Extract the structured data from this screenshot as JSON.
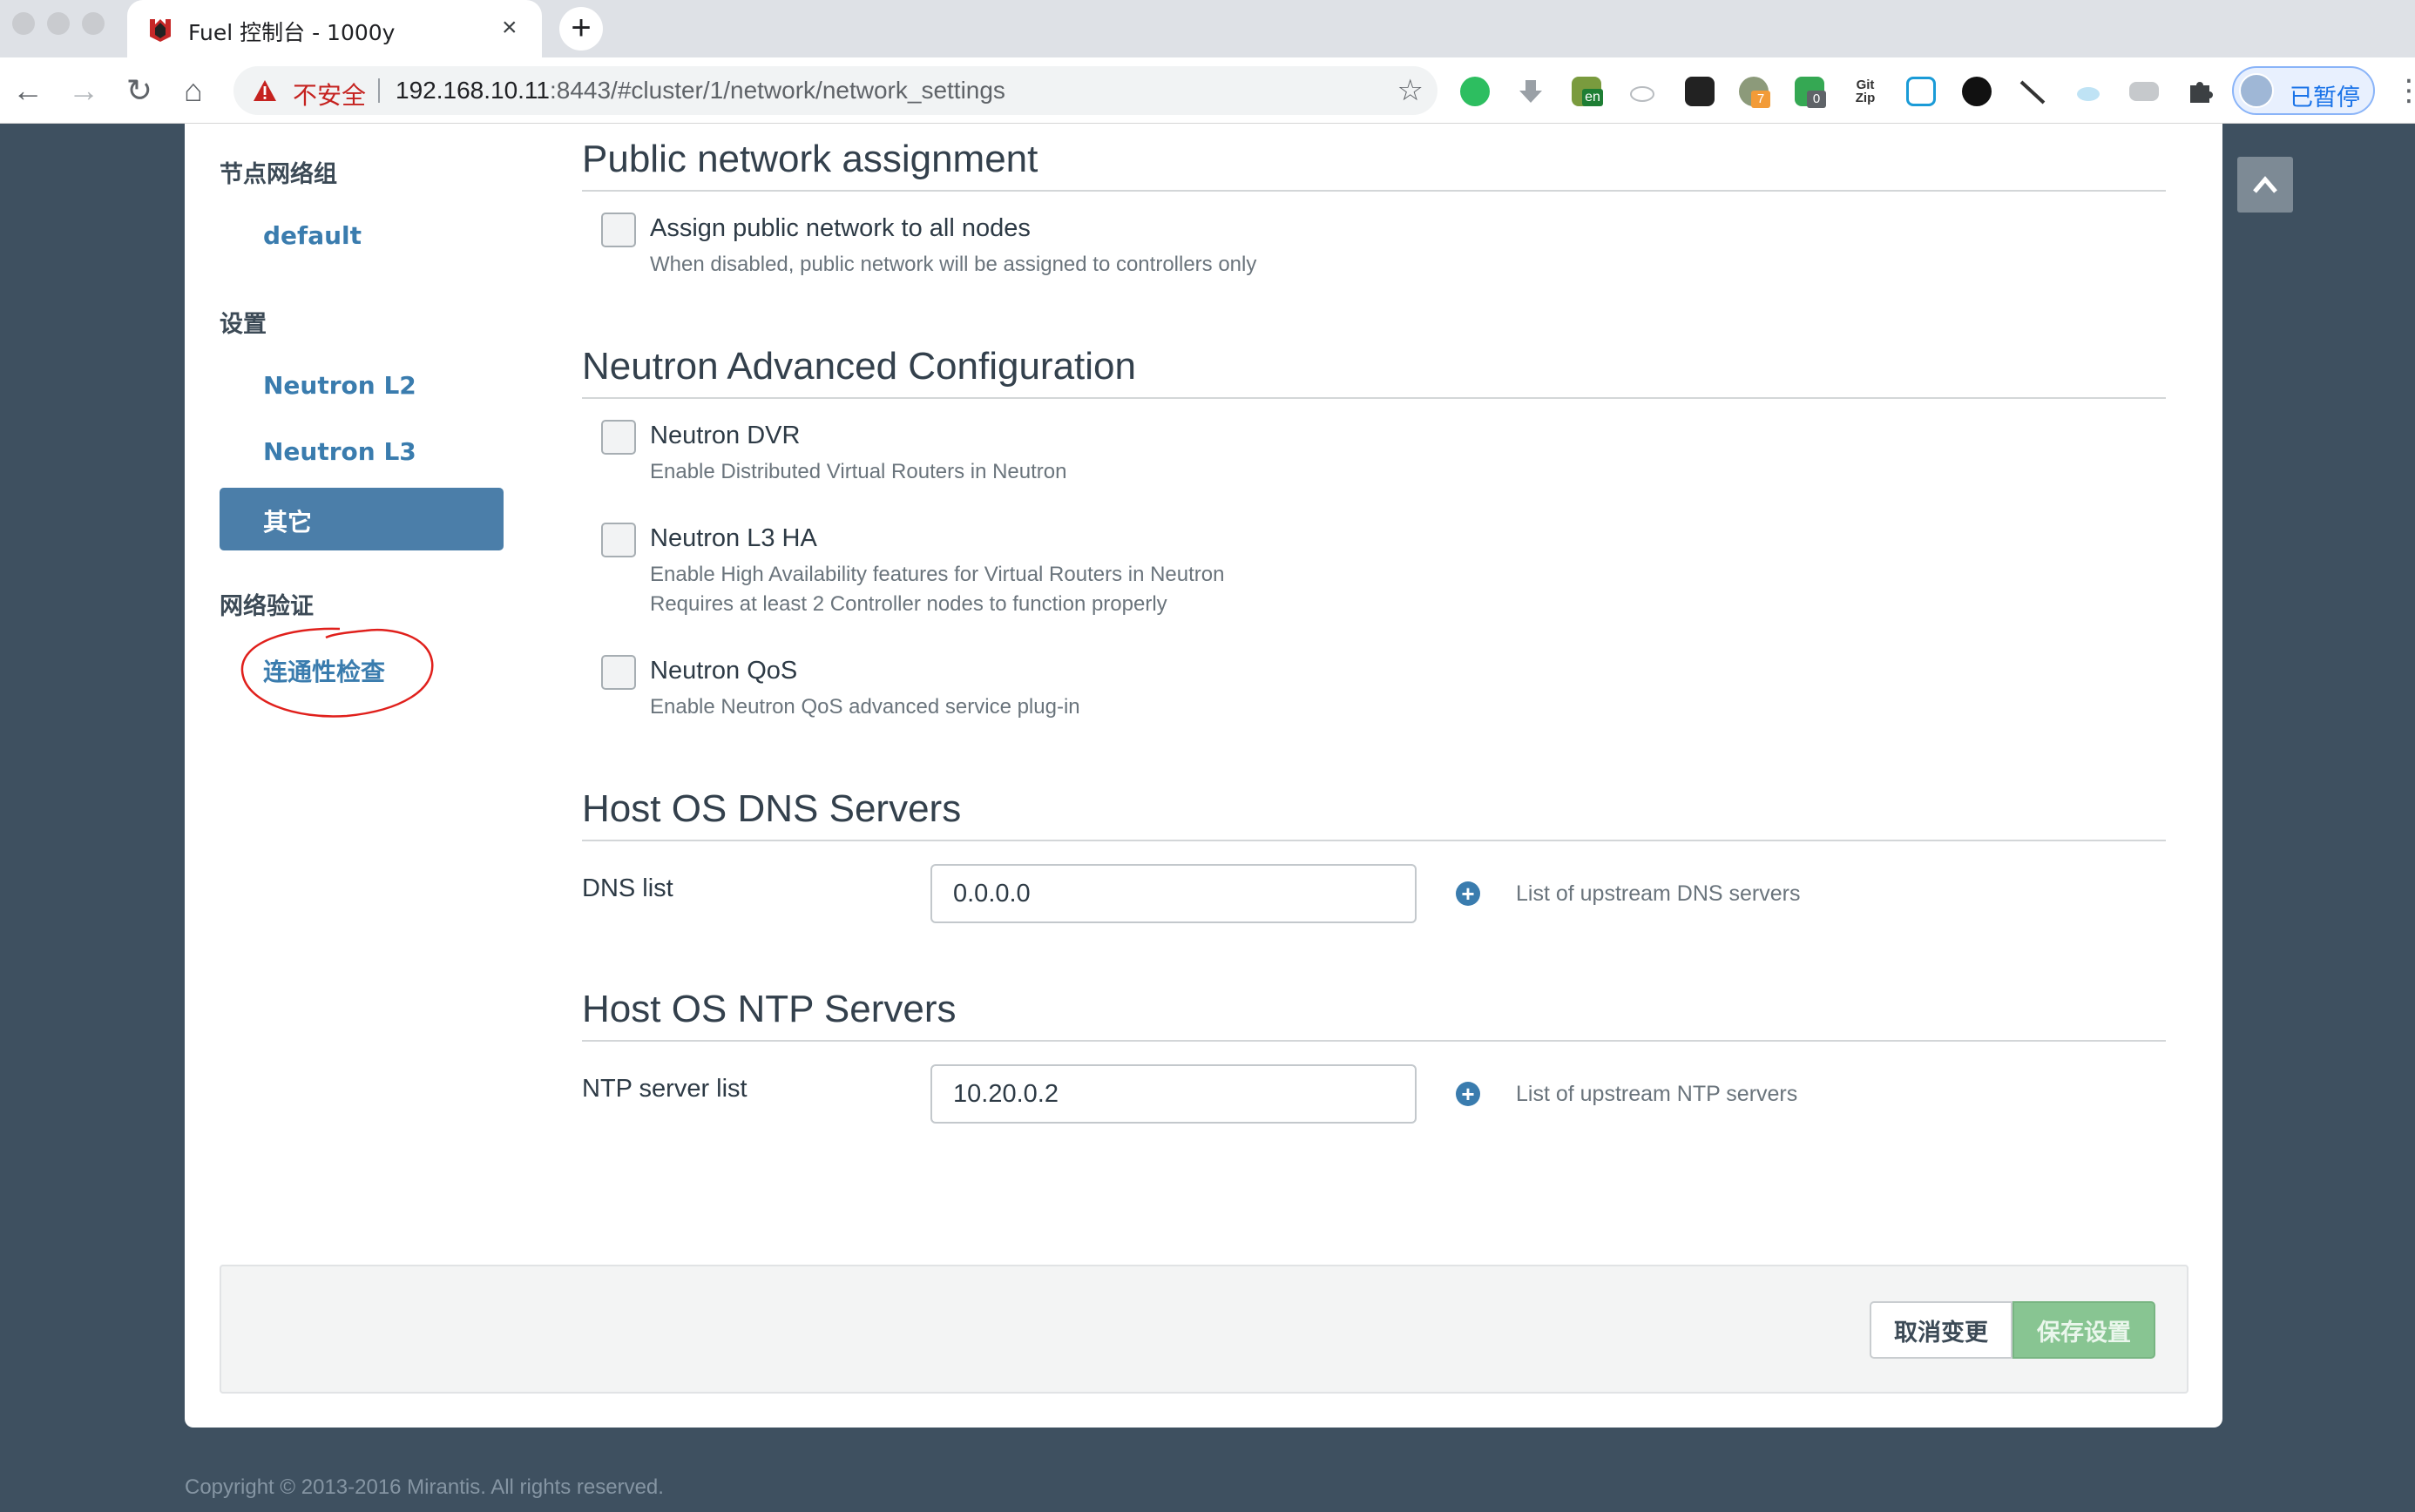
{
  "browser": {
    "tab": {
      "title": "Fuel 控制台 - 1000y"
    },
    "address": {
      "security_label": "不安全",
      "host": "192.168.10.11",
      "path": ":8443/#cluster/1/network/network_settings"
    },
    "profile": {
      "status_label": "已暂停"
    },
    "extensions": [
      "evernote-icon",
      "download-icon",
      "translate-icon",
      "cloud-icon",
      "tampermonkey-icon",
      "extension-counter-icon",
      "adguard-icon",
      "gitzip-icon",
      "screenshot-icon",
      "media-icon",
      "tool-icon",
      "cloud-sync-icon",
      "folder-icon",
      "puzzle-icon"
    ],
    "extension_badges": {
      "counter": "7",
      "adguard": "0",
      "translate": "en"
    }
  },
  "sidebar": {
    "node_groups_heading": "节点网络组",
    "node_groups": [
      "default"
    ],
    "settings_heading": "设置",
    "settings_items": [
      "Neutron L2",
      "Neutron L3",
      "其它"
    ],
    "active_item": "其它",
    "verification_heading": "网络验证",
    "verification_items": [
      "连通性检查"
    ]
  },
  "sections": {
    "public": {
      "title": "Public network assignment",
      "assign_label": "Assign public network to all nodes",
      "assign_desc": "When disabled, public network will be assigned to controllers only"
    },
    "neutron_advanced": {
      "title": "Neutron Advanced Configuration",
      "dvr_label": "Neutron DVR",
      "dvr_desc": "Enable Distributed Virtual Routers in Neutron",
      "l3ha_label": "Neutron L3 HA",
      "l3ha_desc1": "Enable High Availability features for Virtual Routers in Neutron",
      "l3ha_desc2": "Requires at least 2 Controller nodes to function properly",
      "qos_label": "Neutron QoS",
      "qos_desc": "Enable Neutron QoS advanced service plug-in"
    },
    "dns": {
      "title": "Host OS DNS Servers",
      "label": "DNS list",
      "value": "0.0.0.0",
      "help": "List of upstream DNS servers"
    },
    "ntp": {
      "title": "Host OS NTP Servers",
      "label": "NTP server list",
      "value": "10.20.0.2",
      "help": "List of upstream NTP servers"
    }
  },
  "footer": {
    "cancel_label": "取消变更",
    "save_label": "保存设置",
    "copyright": "Copyright © 2013-2016 Mirantis. All rights reserved."
  },
  "colors": {
    "accent": "#3a7cae",
    "active_bg": "#4b7ea9",
    "save_button": "#88c592",
    "page_bg": "#3e5060",
    "annotation": "#e0201c"
  }
}
